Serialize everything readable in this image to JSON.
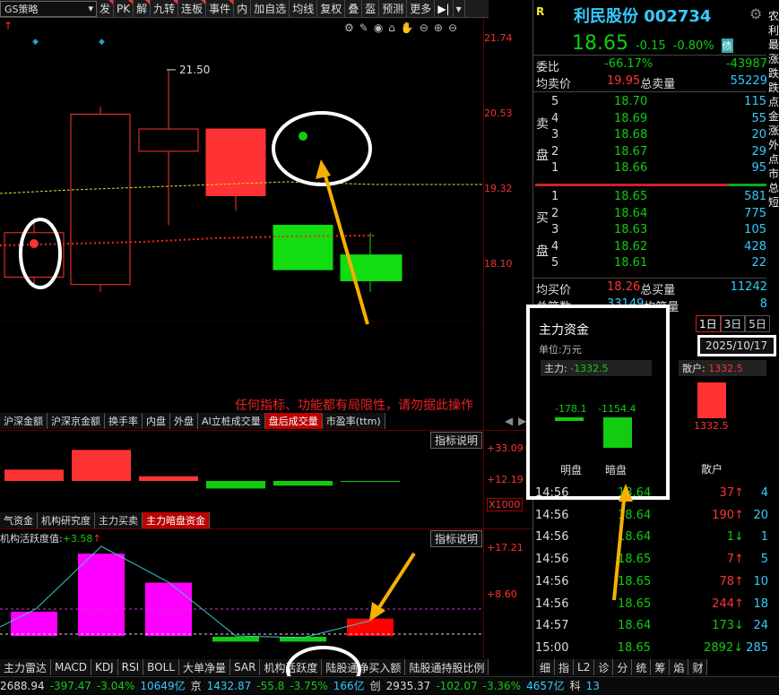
{
  "toolbar": {
    "dropdown": "GS策略",
    "buttons": [
      "发",
      "PK",
      "解",
      "九转",
      "连板",
      "事件",
      "内",
      "加自选",
      "均线",
      "复权",
      "叠",
      "盔",
      "预测",
      "更多"
    ]
  },
  "main_chart": {
    "high_label": "21.50",
    "price_ticks": [
      "21.74",
      "20.53",
      "19.32",
      "18.10"
    ],
    "candles": [
      {
        "open": 18.7,
        "close": 19.3,
        "high": 19.5,
        "low": 18.6,
        "color": "#ff3333",
        "hollow": true
      },
      {
        "open": 18.6,
        "close": 20.9,
        "high": 21.0,
        "low": 18.5,
        "color": "#ff3333",
        "hollow": true
      },
      {
        "open": 20.4,
        "close": 20.7,
        "high": 21.5,
        "low": 19.4,
        "color": "#ff3333",
        "hollow": true
      },
      {
        "open": 20.7,
        "close": 19.8,
        "high": 20.7,
        "low": 19.6,
        "color": "#ff3333",
        "hollow": false
      },
      {
        "open": 19.4,
        "close": 18.8,
        "high": 19.4,
        "low": 18.8,
        "color": "#11dd11",
        "hollow": false
      },
      {
        "open": 19.0,
        "close": 18.65,
        "high": 19.3,
        "low": 18.5,
        "color": "#11dd11",
        "hollow": false
      }
    ],
    "ylim": [
      17.0,
      22.2
    ],
    "warning": "任何指标、功能都有局限性，请勿据此操作"
  },
  "tabs1": [
    "沪深金额",
    "沪深京金额",
    "换手率",
    "内盘",
    "外盘",
    "AI立桩成交量",
    "盘后成交量",
    "市盈率(ttm)"
  ],
  "tabs1_active": "盘后成交量",
  "ind1": {
    "explain": "指标说明",
    "ticks": [
      "+33.09",
      "+12.19"
    ],
    "unit": "X1000",
    "values": [
      12.0,
      33.0,
      5.0,
      -8.0,
      -5.0,
      -1.0
    ]
  },
  "tabs2": [
    "气资金",
    "机构研究度",
    "主力买卖",
    "主力暗盘资金"
  ],
  "tabs2_active": "主力暗盘资金",
  "ind2": {
    "title": "机构活跃度值:",
    "value": "+3.58",
    "explain": "指标说明",
    "ticks": [
      "+17.21",
      "+8.60"
    ],
    "values": [
      5.0,
      17.0,
      11.0,
      -1.0,
      -1.0,
      3.58
    ]
  },
  "bottom_tabs": [
    "主力雷达",
    "MACD",
    "KDJ",
    "RSI",
    "BOLL",
    "大单净量",
    "SAR",
    "机构活跃度",
    "陆股通净买入额",
    "陆股通持股比例"
  ],
  "bottom_active": "机构活跃度",
  "status": [
    "2688.94",
    "-397.47",
    "-3.04%",
    "10649亿",
    "京",
    "1432.87",
    "-55.8",
    "-3.75%",
    "166亿",
    "创",
    "2935.37",
    "-102.07",
    "-3.36%",
    "4657亿",
    "科",
    "13"
  ],
  "stock": {
    "name": "利民股份",
    "code": "002734",
    "price": "18.65",
    "chg": "-0.15",
    "pct": "-0.80%",
    "tag": "债"
  },
  "weibi": {
    "label": "委比",
    "pct": "-66.17%",
    "diff": "-43987"
  },
  "avgsell": {
    "label": "均卖价",
    "price": "19.95",
    "label2": "总卖量",
    "vol": "55229"
  },
  "sell": [
    {
      "n": "5",
      "p": "18.70",
      "v": "115"
    },
    {
      "n": "4",
      "p": "18.69",
      "v": "55"
    },
    {
      "n": "3",
      "p": "18.68",
      "v": "20"
    },
    {
      "n": "2",
      "p": "18.67",
      "v": "29"
    },
    {
      "n": "1",
      "p": "18.66",
      "v": "95"
    }
  ],
  "buy": [
    {
      "n": "1",
      "p": "18.65",
      "v": "581"
    },
    {
      "n": "2",
      "p": "18.64",
      "v": "775"
    },
    {
      "n": "3",
      "p": "18.63",
      "v": "105"
    },
    {
      "n": "4",
      "p": "18.62",
      "v": "428"
    },
    {
      "n": "5",
      "p": "18.61",
      "v": "22"
    }
  ],
  "sellc": [
    "卖",
    "盘"
  ],
  "buyc": [
    "买",
    "盘"
  ],
  "avgbuy": {
    "label": "均买价",
    "price": "18.26",
    "label2": "总买量",
    "vol": "11242"
  },
  "total": {
    "label": "总笔数",
    "val": "33149",
    "label2": "均笔量",
    "val2": "8"
  },
  "fund": {
    "title": "主力资金",
    "unit": "单位:万元",
    "main_label": "主力:",
    "main_val": "-1332.5",
    "retail_label": "散户:",
    "retail_val": "1332.5",
    "bars": [
      {
        "label": "明盘",
        "val": "-178.1"
      },
      {
        "label": "暗盘",
        "val": "-1154.4"
      },
      {
        "label": "散户",
        "val": "1332.5"
      }
    ],
    "periods": [
      "1日",
      "3日",
      "5日"
    ],
    "date": "2025/10/17"
  },
  "ticks": [
    {
      "t": "14:56",
      "p": "18.64",
      "v": "37",
      "d": "4",
      "c": "#f33"
    },
    {
      "t": "14:56",
      "p": "18.64",
      "v": "190",
      "d": "20",
      "c": "#f33"
    },
    {
      "t": "14:56",
      "p": "18.64",
      "v": "1",
      "d": "1",
      "c": "#1c1"
    },
    {
      "t": "14:56",
      "p": "18.65",
      "v": "7",
      "d": "5",
      "c": "#f33"
    },
    {
      "t": "14:56",
      "p": "18.65",
      "v": "78",
      "d": "10",
      "c": "#f33"
    },
    {
      "t": "14:56",
      "p": "18.65",
      "v": "244",
      "d": "18",
      "c": "#f33"
    },
    {
      "t": "14:57",
      "p": "18.64",
      "v": "173",
      "d": "24",
      "c": "#1c1"
    },
    {
      "t": "15:00",
      "p": "18.65",
      "v": "2892",
      "d": "285",
      "c": "#1c1"
    }
  ],
  "right_tabs": [
    "细",
    "指",
    "L2",
    "诊",
    "分",
    "统",
    "筹",
    "焰",
    "财"
  ],
  "side_text": "农 利 最 涨 跌 跌 点 金 涨 外 点 市 总 短"
}
